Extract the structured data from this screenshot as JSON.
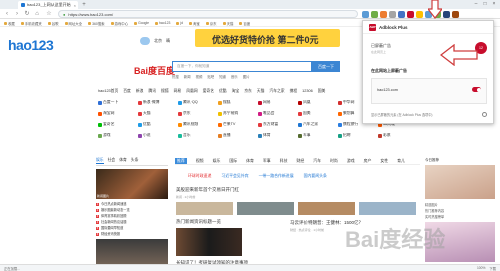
{
  "browser": {
    "tab_title": "hao123_上网从这里开始",
    "address": "https://www.hao123.com/",
    "bookmarks": [
      "收藏",
      "手机收藏夹",
      "谷歌",
      "网址大全",
      "360搜索",
      "游戏中心",
      "Google",
      "hao123",
      "jd",
      "淘宝",
      "京东",
      "天猫",
      "百度"
    ]
  },
  "page": {
    "logo": "hao123",
    "weather_city": "北京",
    "weather_temp": "晴",
    "banner_text": "优选好货特价抢 第二件0元",
    "baidu_logo": "Bai度百度",
    "search_placeholder": "百度一下，你就知道",
    "search_button": "百度一下",
    "hotwords": [
      "热搜",
      "新闻",
      "视频",
      "贴吧",
      "知道",
      "音乐",
      "图片"
    ],
    "nav_row": [
      "hao123首页",
      "百度",
      "新浪",
      "腾讯",
      "搜狐",
      "网易",
      "凤凰网",
      "爱奇艺",
      "优酷",
      "淘宝",
      "京东",
      "天猫",
      "汽车之家",
      "携程",
      "12306",
      "国美"
    ],
    "sites": [
      {
        "label": "百度一下",
        "color": "#2f6fd6"
      },
      {
        "label": "新浪·微博",
        "color": "#e4393c"
      },
      {
        "label": "腾讯·QQ",
        "color": "#1e9be8"
      },
      {
        "label": "搜狐",
        "color": "#f0a020"
      },
      {
        "label": "网易",
        "color": "#c70d2c"
      },
      {
        "label": "凤凰",
        "color": "#b40000"
      },
      {
        "label": "中华网",
        "color": "#d32f2f"
      },
      {
        "label": "12306",
        "color": "#2a6fd0"
      },
      {
        "label": "淘宝网",
        "color": "#ff5000"
      },
      {
        "label": "天猫",
        "color": "#e4393c"
      },
      {
        "label": "京东",
        "color": "#e4393c"
      },
      {
        "label": "苏宁易购",
        "color": "#f0c000"
      },
      {
        "label": "唯品会",
        "color": "#d01c84"
      },
      {
        "label": "国美",
        "color": "#e4393c"
      },
      {
        "label": "聚划算",
        "color": "#ff6600"
      },
      {
        "label": "1号店",
        "color": "#e4393c"
      },
      {
        "label": "爱奇艺",
        "color": "#00be06"
      },
      {
        "label": "优酷",
        "color": "#1e9be8"
      },
      {
        "label": "腾讯视频",
        "color": "#ff8a00"
      },
      {
        "label": "芒果TV",
        "color": "#ff6a00"
      },
      {
        "label": "东方财富",
        "color": "#e4393c"
      },
      {
        "label": "汽车之家",
        "color": "#1e76d3"
      },
      {
        "label": "携程旅行",
        "color": "#2a7de1"
      },
      {
        "label": "58同城",
        "color": "#ff5a00"
      },
      {
        "label": "游戏",
        "color": "#6aa84f"
      },
      {
        "label": "小说",
        "color": "#8e44ad"
      },
      {
        "label": "音乐",
        "color": "#1abc9c"
      },
      {
        "label": "直播",
        "color": "#e67e22"
      },
      {
        "label": "体育",
        "color": "#2980b9"
      },
      {
        "label": "军事",
        "color": "#556b2f"
      },
      {
        "label": "招聘",
        "color": "#16a085"
      },
      {
        "label": "彩票",
        "color": "#c0392b"
      }
    ],
    "left_tabs": [
      "娱乐",
      "社会",
      "体育",
      "头条"
    ],
    "left_img_caption": "新闻图片",
    "left_list": [
      "今日热点新闻速递",
      "娱乐圈最新动态一览",
      "体育赛事精彩回顾",
      "社会新闻热议话题",
      "国际要闻早知道",
      "财经资讯快报"
    ],
    "feed_tabs": [
      "推荐",
      "视频",
      "娱乐",
      "国际",
      "体育",
      "军事",
      "科技",
      "财经",
      "汽车",
      "时尚",
      "游戏",
      "房产",
      "女性",
      "育儿"
    ],
    "headlines": [
      "环球时政速递",
      "习近平会见外宾",
      "一带一路合作新进展",
      "国内要闻头条"
    ],
    "news1": "美股迎来新年首个交易日开门红",
    "news1_sub": "新闻 · 2小时前",
    "news2": "热门新闻资讯标题一览",
    "news3": "马云评价特朗普：王健林：1500亿？",
    "news3_sub": "财经 · 热点评论 · 1小时前",
    "news4": "长知识了！考研复试须知的注意事项",
    "right_top": "今日推荐",
    "right_list": [
      "精选图片",
      "热门推荐内容",
      "实时热搜榜单"
    ],
    "watermark": "Bai度经验",
    "status_left": "正在加载…",
    "status_right": [
      "100%",
      "下载"
    ]
  },
  "popup": {
    "title": "Adblock Plus",
    "blocked_label": "已屏蔽广告",
    "blocked_sub": "在此网页上",
    "blocked_count": "12",
    "section_title": "在此网站上屏蔽广告",
    "domain": "hao123.com",
    "footer": "显示已屏蔽的元素 (在 Adblock Plus 选项中)"
  },
  "colors": {
    "accent": "#3c86d3",
    "abp_red": "#c70d2c",
    "arrow": "#cf3e3e"
  }
}
